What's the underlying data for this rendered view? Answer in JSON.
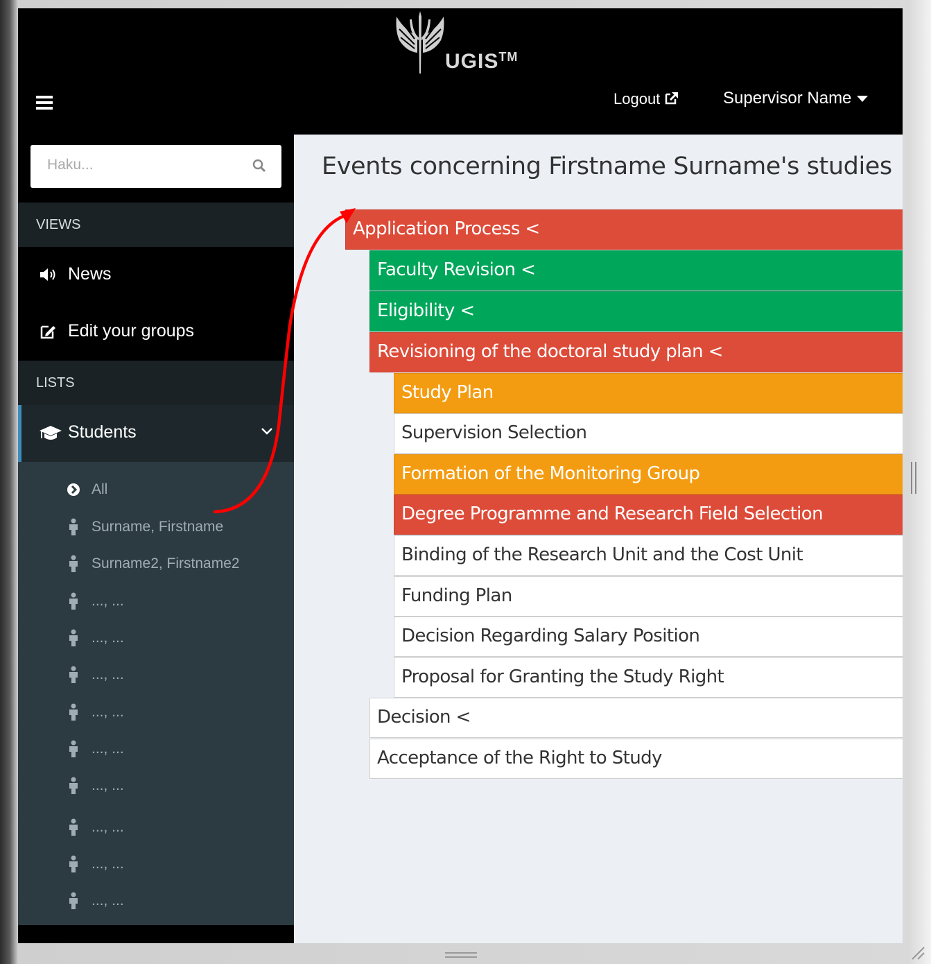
{
  "app": {
    "name": "UGIS",
    "trademark": "TM"
  },
  "header": {
    "logout_label": "Logout",
    "user_name": "Supervisor Name"
  },
  "sidebar": {
    "search_placeholder": "Haku...",
    "views_header": "VIEWS",
    "views": [
      {
        "label": "News",
        "icon": "volume-icon"
      },
      {
        "label": "Edit your groups",
        "icon": "edit-icon"
      }
    ],
    "lists_header": "LISTS",
    "students": {
      "label": "Students",
      "icon": "graduation-cap-icon",
      "items": [
        {
          "label": "All",
          "icon": "arrow-circle-right-icon"
        },
        {
          "label": "Surname, Firstname",
          "icon": "person-icon"
        },
        {
          "label": "Surname2, Firstname2",
          "icon": "person-icon"
        },
        {
          "label": "..., ...",
          "icon": "person-icon"
        },
        {
          "label": "..., ...",
          "icon": "person-icon"
        },
        {
          "label": "..., ...",
          "icon": "person-icon"
        },
        {
          "label": "..., ...",
          "icon": "person-icon"
        },
        {
          "label": "..., ...",
          "icon": "person-icon"
        },
        {
          "label": "..., ...",
          "icon": "person-icon"
        },
        {
          "label": "..., ...",
          "icon": "person-icon"
        },
        {
          "label": "..., ...",
          "icon": "person-icon"
        },
        {
          "label": "..., ...",
          "icon": "person-icon"
        }
      ]
    }
  },
  "main": {
    "title": "Events concerning Firstname Surname's studies",
    "events": [
      {
        "label": "Application Process <",
        "status": "red"
      },
      {
        "label": "Faculty Revision <",
        "status": "green"
      },
      {
        "label": "Eligibility <",
        "status": "green"
      },
      {
        "label": "Revisioning of the doctoral study plan <",
        "status": "red"
      },
      {
        "label": "Study Plan",
        "status": "orange"
      },
      {
        "label": "Supervision Selection",
        "status": "white"
      },
      {
        "label": "Formation of the Monitoring Group",
        "status": "orange"
      },
      {
        "label": "Degree Programme and Research Field Selection",
        "status": "red"
      },
      {
        "label": "Binding of the Research Unit and the Cost Unit",
        "status": "white"
      },
      {
        "label": "Funding Plan",
        "status": "white"
      },
      {
        "label": "Decision Regarding Salary Position",
        "status": "white"
      },
      {
        "label": "Proposal for Granting the Study Right",
        "status": "white"
      },
      {
        "label": "Decision <",
        "status": "white"
      },
      {
        "label": "Acceptance of the Right to Study",
        "status": "white"
      }
    ]
  },
  "colors": {
    "red": "#dd4b39",
    "green": "#00a65a",
    "orange": "#f39c12",
    "accent": "#3c8dbc",
    "arrow": "#ff0000"
  }
}
